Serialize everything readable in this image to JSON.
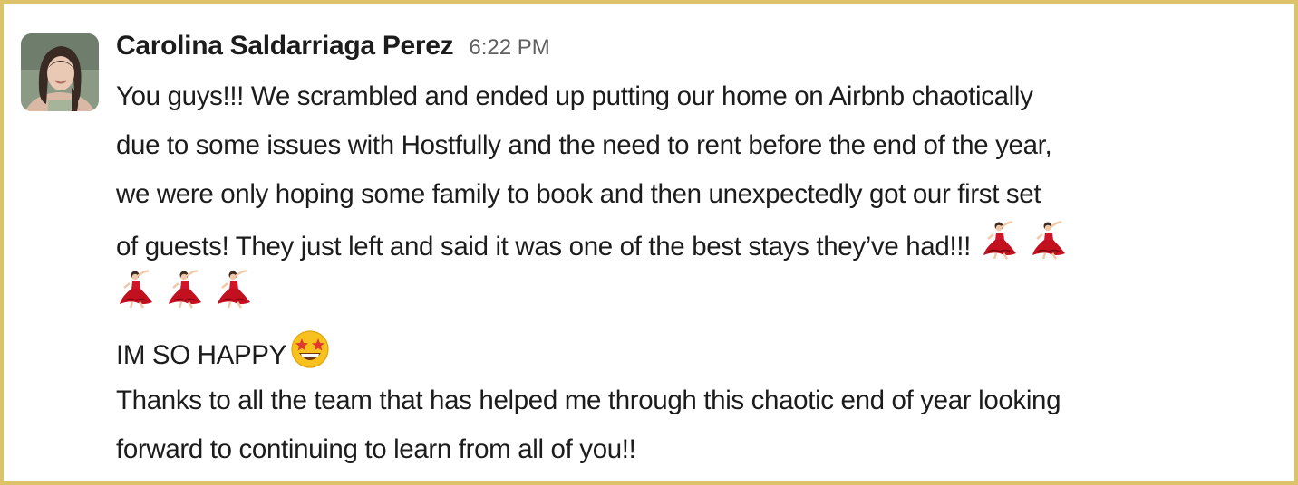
{
  "message": {
    "author": "Carolina Saldarriaga Perez",
    "timestamp": "6:22 PM",
    "paragraph1_lines": [
      "You guys!!! We scrambled and ended up putting our home on Airbnb chaotically",
      "due to some issues with Hostfully and the need to rent before the end of the year,",
      "we were only hoping some family to book and then unexpectedly got our first set",
      "of guests! They just left and said it was one of the best stays they’ve had!!!"
    ],
    "paragraph2": "IM SO HAPPY",
    "paragraph3_lines": [
      "Thanks to all the team that has helped me through this chaotic end of year looking",
      "forward to continuing to learn from all of you!!"
    ],
    "emojis": {
      "dancer": "woman-dancing-emoji",
      "dancer_count": 5,
      "happy": "star-struck-emoji"
    }
  },
  "colors": {
    "frame_border": "#dcc36a",
    "text": "#1d1c1d",
    "timestamp": "#616061"
  }
}
